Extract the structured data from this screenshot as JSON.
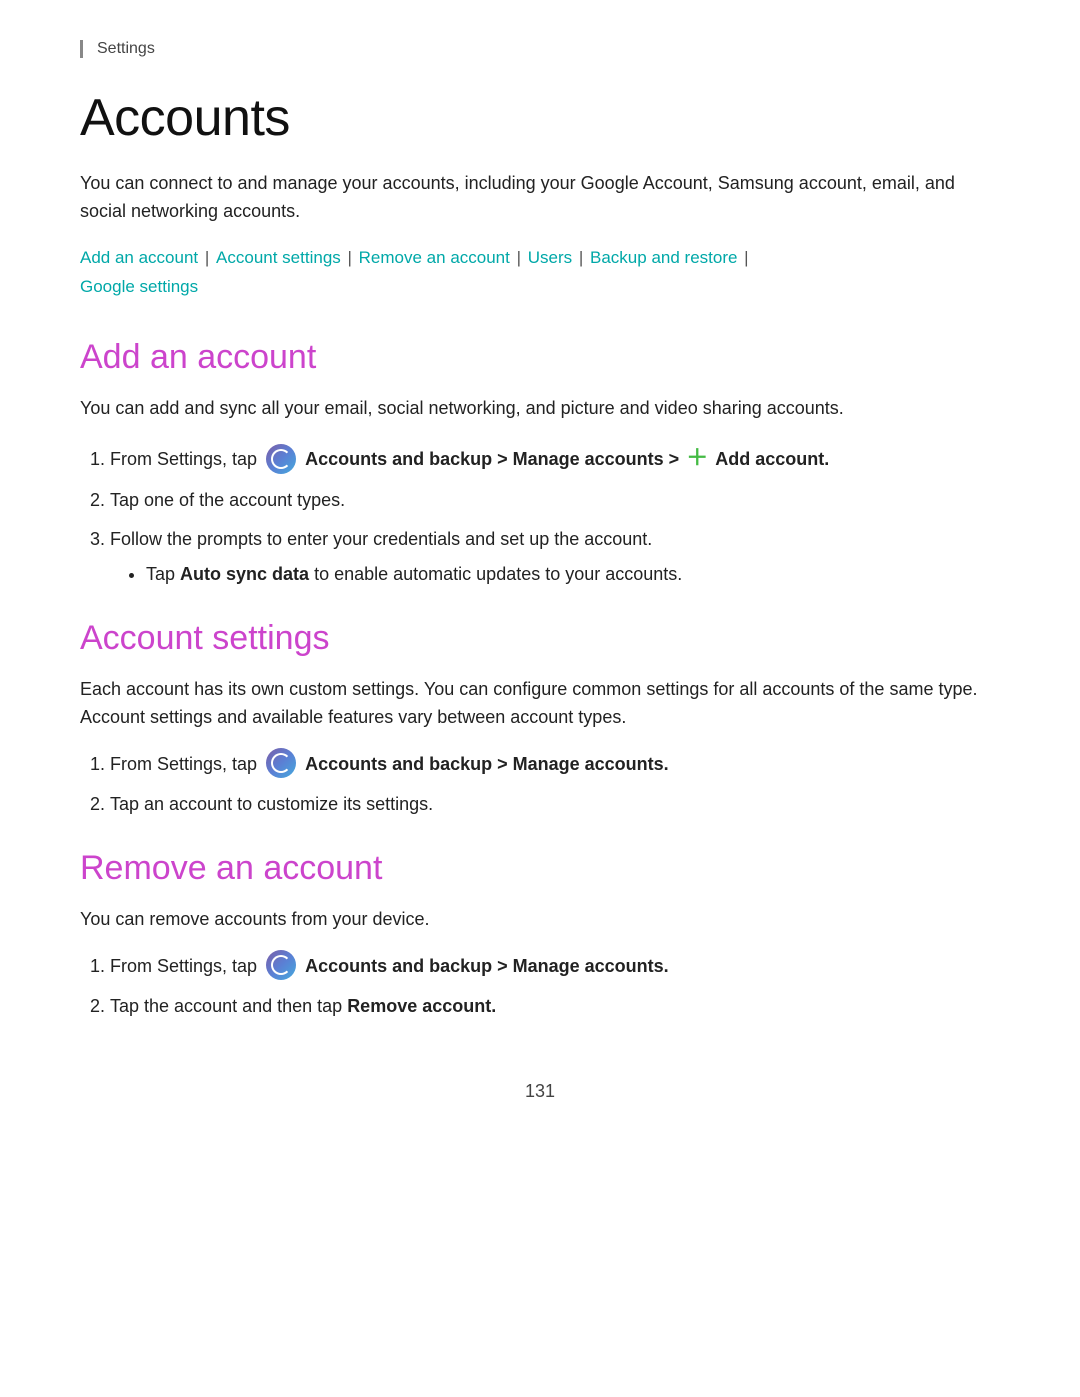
{
  "settings_label": "Settings",
  "page_title": "Accounts",
  "intro_text": "You can connect to and manage your accounts, including your Google Account, Samsung account, email, and social networking accounts.",
  "nav_links": [
    {
      "label": "Add an account",
      "id": "add-an-account"
    },
    {
      "label": "Account settings",
      "id": "account-settings"
    },
    {
      "label": "Remove an account",
      "id": "remove-an-account"
    },
    {
      "label": "Users",
      "id": "users"
    },
    {
      "label": "Backup and restore",
      "id": "backup-and-restore"
    },
    {
      "label": "Google settings",
      "id": "google-settings"
    }
  ],
  "sections": {
    "add_account": {
      "title": "Add an account",
      "desc": "You can add and sync all your email, social networking, and picture and video sharing accounts.",
      "steps": [
        {
          "html_key": "add_step1",
          "text_before": "From Settings, tap ",
          "bold_text": "Accounts and backup > Manage accounts > ",
          "plus": true,
          "bold_after": "Add account",
          "period": "."
        },
        {
          "html_key": "add_step2",
          "text": "Tap one of the account types."
        },
        {
          "html_key": "add_step3",
          "text": "Follow the prompts to enter your credentials and set up the account.",
          "sub_bullet": "Tap Auto sync data to enable automatic updates to your accounts."
        }
      ]
    },
    "account_settings": {
      "title": "Account settings",
      "desc": "Each account has its own custom settings. You can configure common settings for all accounts of the same type. Account settings and available features vary between account types.",
      "steps": [
        {
          "html_key": "as_step1",
          "text_before": "From Settings, tap ",
          "bold_text": "Accounts and backup > Manage accounts",
          "period": "."
        },
        {
          "html_key": "as_step2",
          "text": "Tap an account to customize its settings."
        }
      ]
    },
    "remove_account": {
      "title": "Remove an account",
      "desc": "You can remove accounts from your device.",
      "steps": [
        {
          "html_key": "ra_step1",
          "text_before": "From Settings, tap ",
          "bold_text": "Accounts and backup > Manage accounts",
          "period": "."
        },
        {
          "html_key": "ra_step2",
          "text_before": "Tap the account and then tap ",
          "bold_after": "Remove account",
          "period": "."
        }
      ]
    }
  },
  "footer": {
    "page_number": "131"
  }
}
